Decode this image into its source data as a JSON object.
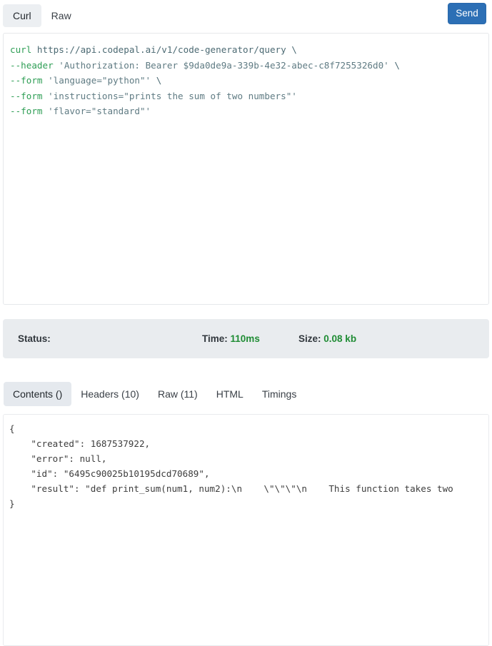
{
  "request": {
    "tabs": [
      {
        "label": "Curl",
        "active": true
      },
      {
        "label": "Raw",
        "active": false
      }
    ],
    "send_label": "Send",
    "curl_lines": [
      [
        {
          "t": "curl ",
          "c": "cmd"
        },
        {
          "t": "https://api.codepal.ai/v1/code-generator/query",
          "c": "url"
        },
        {
          "t": " \\",
          "c": "plain"
        }
      ],
      [
        {
          "t": "--header",
          "c": "flag"
        },
        {
          "t": " 'Authorization: Bearer $9da0de9a-339b-4e32-abec-c8f7255326d0'",
          "c": "str"
        },
        {
          "t": " \\",
          "c": "plain"
        }
      ],
      [
        {
          "t": "--form",
          "c": "flag"
        },
        {
          "t": " 'language=\"python\"'",
          "c": "str"
        },
        {
          "t": " \\",
          "c": "plain"
        }
      ],
      [
        {
          "t": "--form",
          "c": "flag"
        },
        {
          "t": " 'instructions=\"prints the sum of two numbers\"'",
          "c": "str"
        }
      ],
      [
        {
          "t": "--form",
          "c": "flag"
        },
        {
          "t": " 'flavor=\"standard\"'",
          "c": "str"
        }
      ]
    ]
  },
  "status_bar": {
    "status_label": "Status:",
    "status_value": "",
    "time_label": "Time:",
    "time_value": "110ms",
    "size_label": "Size:",
    "size_value": "0.08 kb",
    "value_color": "#1f8c34"
  },
  "response": {
    "tabs": [
      {
        "label": "Contents ()",
        "active": true
      },
      {
        "label": "Headers (10)",
        "active": false
      },
      {
        "label": "Raw (11)",
        "active": false
      },
      {
        "label": "HTML",
        "active": false
      },
      {
        "label": "Timings",
        "active": false
      }
    ],
    "json_lines": [
      "{",
      "    \"created\": 1687537922,",
      "    \"error\": null,",
      "    \"id\": \"6495c90025b10195dcd70689\",",
      "    \"result\": \"def print_sum(num1, num2):\\n    \\\"\\\"\\\"\\n    This function takes two",
      "}"
    ]
  },
  "theme": {
    "accent_blue": "#2c6fb5",
    "status_bg": "#e9ecef",
    "active_tab_bg": "#eceff2",
    "panel_border": "#e6e8eb",
    "code_green": "#2e9e55",
    "code_string": "#5f7b83"
  }
}
